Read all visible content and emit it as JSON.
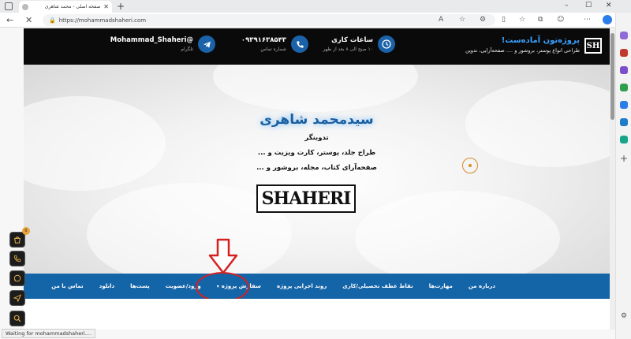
{
  "browser": {
    "tab_title": "صفحه اصلی - محمد شاهری",
    "new_tab": "+",
    "url": "https://mohammadshaheri.com",
    "minimize": "–",
    "maximize": "☐",
    "close": "✕",
    "status_text": "Waiting for mohammadshaheri...."
  },
  "topbar": {
    "logo": "SH",
    "promo_title": "پروژه‌تون آماده‌ست!",
    "promo_sub": "طراحی انواع پوستر، بروشور و .... صفحه‌آرایی، تدوین",
    "hours_title": "ساعات کاری",
    "hours_sub": "۱۰ صبح الی ۸ بعد از ظهر",
    "phone_title": "۰۹۳۹۱۶۳۸۵۴۳",
    "phone_sub": "شماره تماس",
    "telegram_title": "@Mohammad_Shaheri",
    "telegram_sub": "تلگرام"
  },
  "hero": {
    "name": "سیدمحمد شاهری",
    "line1": "تدوینگر",
    "line2": "طراح جلد، پوستر، کارت ویزیت و ...",
    "line3": "صفحه‌آرای کتاب، مجله، بروشور و ...",
    "logo_text": "SHAHERI"
  },
  "nav": {
    "items": [
      "درباره من",
      "مهارت‌ها",
      "نقاط عطف تحصیلی/کاری",
      "روند اجرایی پروژه",
      "سفارش پروژه",
      "ورود/عضویت",
      "پست‌ها",
      "دانلود",
      "تماس با من"
    ],
    "order_caret": "▾"
  },
  "floating": {
    "cart_badge": "0"
  },
  "colors": {
    "accent_blue": "#1464a8",
    "topbar_bg": "#0a0a0a",
    "annotation_red": "#d62020",
    "float_icon": "#e8b24a"
  },
  "icons": [
    "clock-icon",
    "phone-icon",
    "telegram-icon",
    "cart-icon",
    "whatsapp-icon",
    "send-icon",
    "search-icon"
  ]
}
